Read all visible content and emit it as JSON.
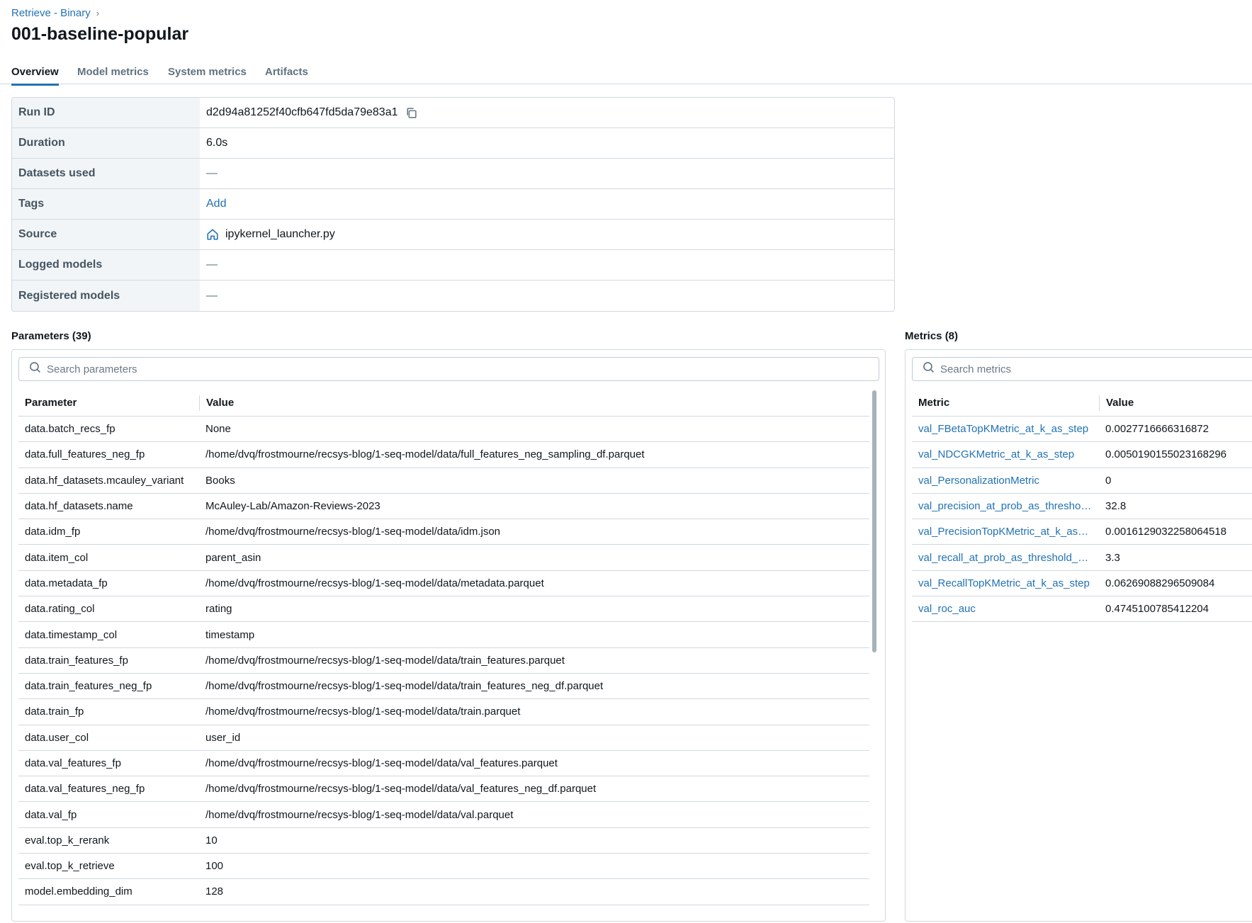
{
  "breadcrumb": {
    "label": "Retrieve - Binary",
    "chevron": "›"
  },
  "page_title": "001-baseline-popular",
  "tabs": [
    {
      "label": "Overview",
      "active": true
    },
    {
      "label": "Model metrics",
      "active": false
    },
    {
      "label": "System metrics",
      "active": false
    },
    {
      "label": "Artifacts",
      "active": false
    }
  ],
  "run_info": {
    "run_id": {
      "label": "Run ID",
      "value": "d2d94a81252f40cfb647fd5da79e83a1",
      "icon": "copy-icon"
    },
    "duration": {
      "label": "Duration",
      "value": "6.0s"
    },
    "datasets_used": {
      "label": "Datasets used",
      "value": "—"
    },
    "tags": {
      "label": "Tags",
      "value": "Add"
    },
    "source": {
      "label": "Source",
      "value": "ipykernel_launcher.py",
      "icon": "home-icon"
    },
    "logged_models": {
      "label": "Logged models",
      "value": "—"
    },
    "registered_models": {
      "label": "Registered models",
      "value": "—"
    }
  },
  "parameters": {
    "title": "Parameters (39)",
    "search_placeholder": "Search parameters",
    "col_parameter": "Parameter",
    "col_value": "Value",
    "rows": [
      {
        "name": "data.batch_recs_fp",
        "value": "None"
      },
      {
        "name": "data.full_features_neg_fp",
        "value": "/home/dvq/frostmourne/recsys-blog/1-seq-model/data/full_features_neg_sampling_df.parquet"
      },
      {
        "name": "data.hf_datasets.mcauley_variant",
        "value": "Books"
      },
      {
        "name": "data.hf_datasets.name",
        "value": "McAuley-Lab/Amazon-Reviews-2023"
      },
      {
        "name": "data.idm_fp",
        "value": "/home/dvq/frostmourne/recsys-blog/1-seq-model/data/idm.json"
      },
      {
        "name": "data.item_col",
        "value": "parent_asin"
      },
      {
        "name": "data.metadata_fp",
        "value": "/home/dvq/frostmourne/recsys-blog/1-seq-model/data/metadata.parquet"
      },
      {
        "name": "data.rating_col",
        "value": "rating"
      },
      {
        "name": "data.timestamp_col",
        "value": "timestamp"
      },
      {
        "name": "data.train_features_fp",
        "value": "/home/dvq/frostmourne/recsys-blog/1-seq-model/data/train_features.parquet"
      },
      {
        "name": "data.train_features_neg_fp",
        "value": "/home/dvq/frostmourne/recsys-blog/1-seq-model/data/train_features_neg_df.parquet"
      },
      {
        "name": "data.train_fp",
        "value": "/home/dvq/frostmourne/recsys-blog/1-seq-model/data/train.parquet"
      },
      {
        "name": "data.user_col",
        "value": "user_id"
      },
      {
        "name": "data.val_features_fp",
        "value": "/home/dvq/frostmourne/recsys-blog/1-seq-model/data/val_features.parquet"
      },
      {
        "name": "data.val_features_neg_fp",
        "value": "/home/dvq/frostmourne/recsys-blog/1-seq-model/data/val_features_neg_df.parquet"
      },
      {
        "name": "data.val_fp",
        "value": "/home/dvq/frostmourne/recsys-blog/1-seq-model/data/val.parquet"
      },
      {
        "name": "eval.top_k_rerank",
        "value": "10"
      },
      {
        "name": "eval.top_k_retrieve",
        "value": "100"
      },
      {
        "name": "model.embedding_dim",
        "value": "128"
      }
    ]
  },
  "metrics": {
    "title": "Metrics (8)",
    "search_placeholder": "Search metrics",
    "col_metric": "Metric",
    "col_value": "Value",
    "rows": [
      {
        "name": "val_FBetaTopKMetric_at_k_as_step",
        "value": "0.0027716666316872"
      },
      {
        "name": "val_NDCGKMetric_at_k_as_step",
        "value": "0.0050190155023168296"
      },
      {
        "name": "val_PersonalizationMetric",
        "value": "0"
      },
      {
        "name": "val_precision_at_prob_as_threshold_step",
        "value": "32.8"
      },
      {
        "name": "val_PrecisionTopKMetric_at_k_as_step",
        "value": "0.0016129032258064518"
      },
      {
        "name": "val_recall_at_prob_as_threshold_step",
        "value": "3.3"
      },
      {
        "name": "val_RecallTopKMetric_at_k_as_step",
        "value": "0.06269088296509084"
      },
      {
        "name": "val_roc_auc",
        "value": "0.4745100785412204"
      }
    ]
  }
}
